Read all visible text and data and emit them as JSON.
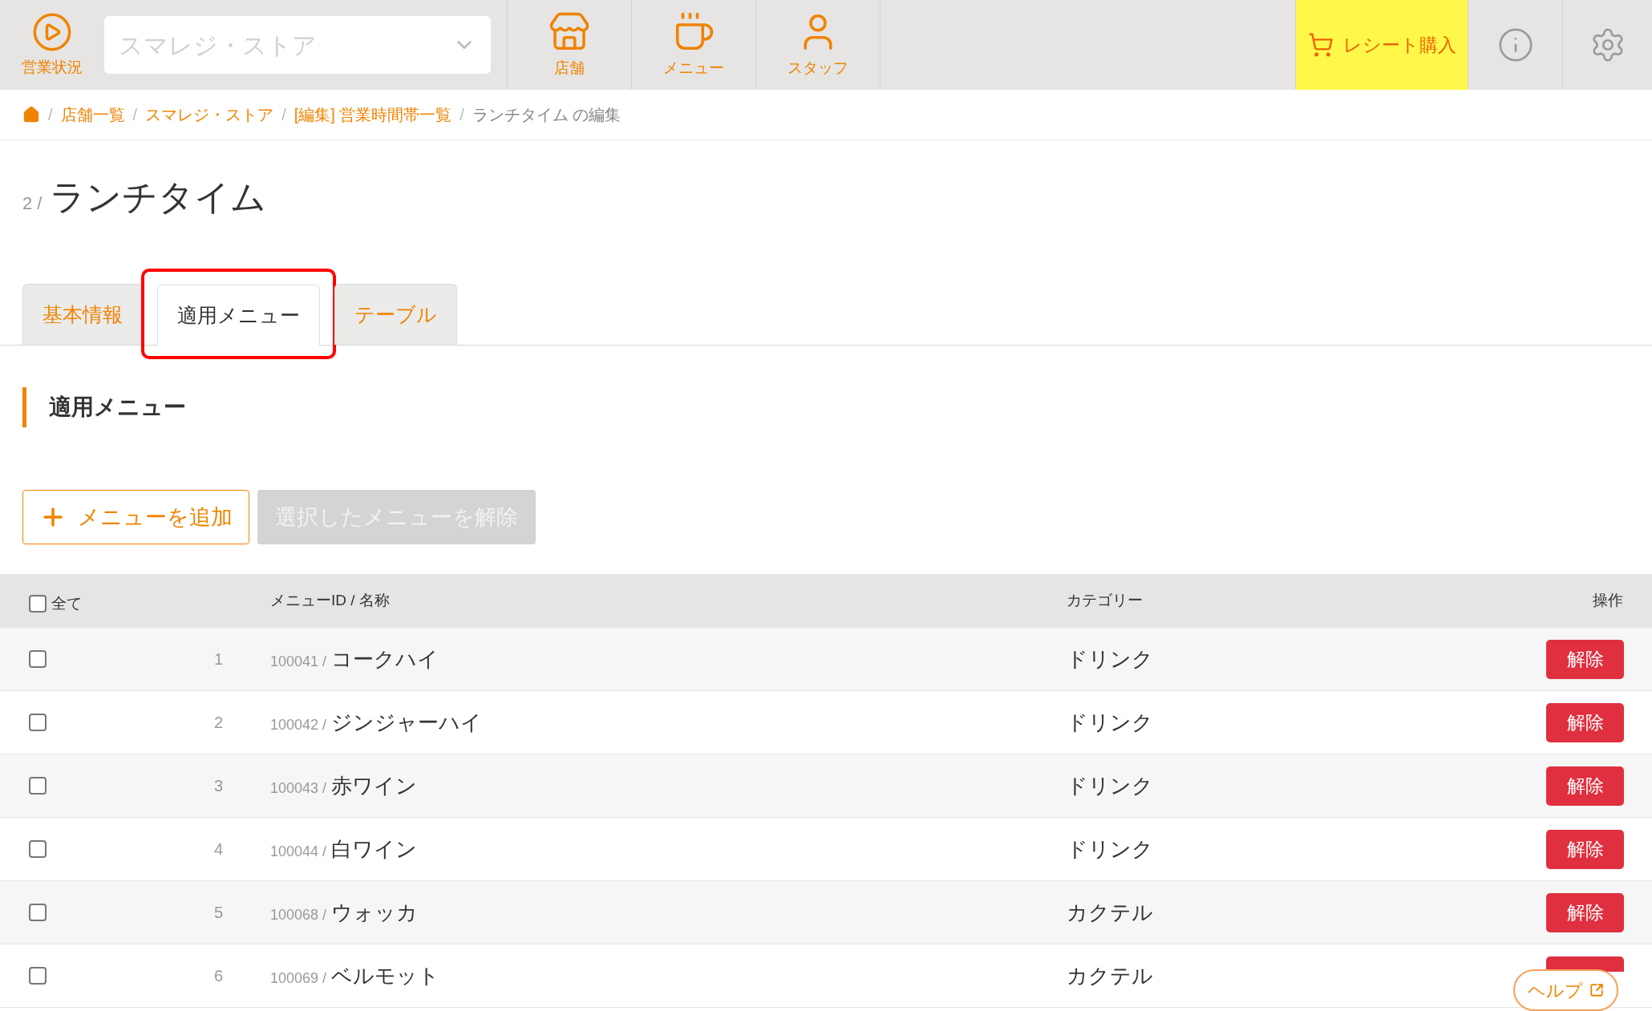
{
  "header": {
    "status_label": "営業状況",
    "store_select": {
      "placeholder": "スマレジ・ストア"
    },
    "nav": [
      {
        "label": "店舗"
      },
      {
        "label": "メニュー"
      },
      {
        "label": "スタッフ"
      }
    ],
    "receipt_button": "レシート購入"
  },
  "breadcrumb": [
    {
      "separator": "/",
      "label": "店舗一覧",
      "link": true
    },
    {
      "separator": "/",
      "label": "スマレジ・ストア",
      "link": true
    },
    {
      "separator": "/",
      "label": "[編集] 営業時間帯一覧",
      "link": true
    },
    {
      "separator": "/",
      "label": "ランチタイム の編集",
      "link": false
    }
  ],
  "title": {
    "number": "2 /",
    "name": "ランチタイム"
  },
  "tabs": [
    {
      "label": "基本情報",
      "selected": false,
      "highlighted": false
    },
    {
      "label": "適用メニュー",
      "selected": true,
      "highlighted": true
    },
    {
      "label": "テーブル",
      "selected": false,
      "highlighted": false
    }
  ],
  "section_title": "適用メニュー",
  "buttons": {
    "add": "メニューを追加",
    "remove": {
      "label": "選択したメニューを解除",
      "disabled": true
    }
  },
  "table": {
    "select_all": {
      "label": "全て",
      "checked": false
    },
    "columns": [
      "メニューID / 名称",
      "カテゴリー",
      "操作"
    ],
    "rows": [
      {
        "checked": false,
        "no": "1",
        "id": "100041 /",
        "name": "コークハイ",
        "category": "ドリンク",
        "action": "解除"
      },
      {
        "checked": false,
        "no": "2",
        "id": "100042 /",
        "name": "ジンジャーハイ",
        "category": "ドリンク",
        "action": "解除"
      },
      {
        "checked": false,
        "no": "3",
        "id": "100043 /",
        "name": "赤ワイン",
        "category": "ドリンク",
        "action": "解除"
      },
      {
        "checked": false,
        "no": "4",
        "id": "100044 /",
        "name": "白ワイン",
        "category": "ドリンク",
        "action": "解除"
      },
      {
        "checked": false,
        "no": "5",
        "id": "100068 /",
        "name": "ウォッカ",
        "category": "カクテル",
        "action": "解除"
      },
      {
        "checked": false,
        "no": "6",
        "id": "100069 /",
        "name": "ベルモット",
        "category": "カクテル"
      }
    ]
  },
  "help": "ヘルプ"
}
